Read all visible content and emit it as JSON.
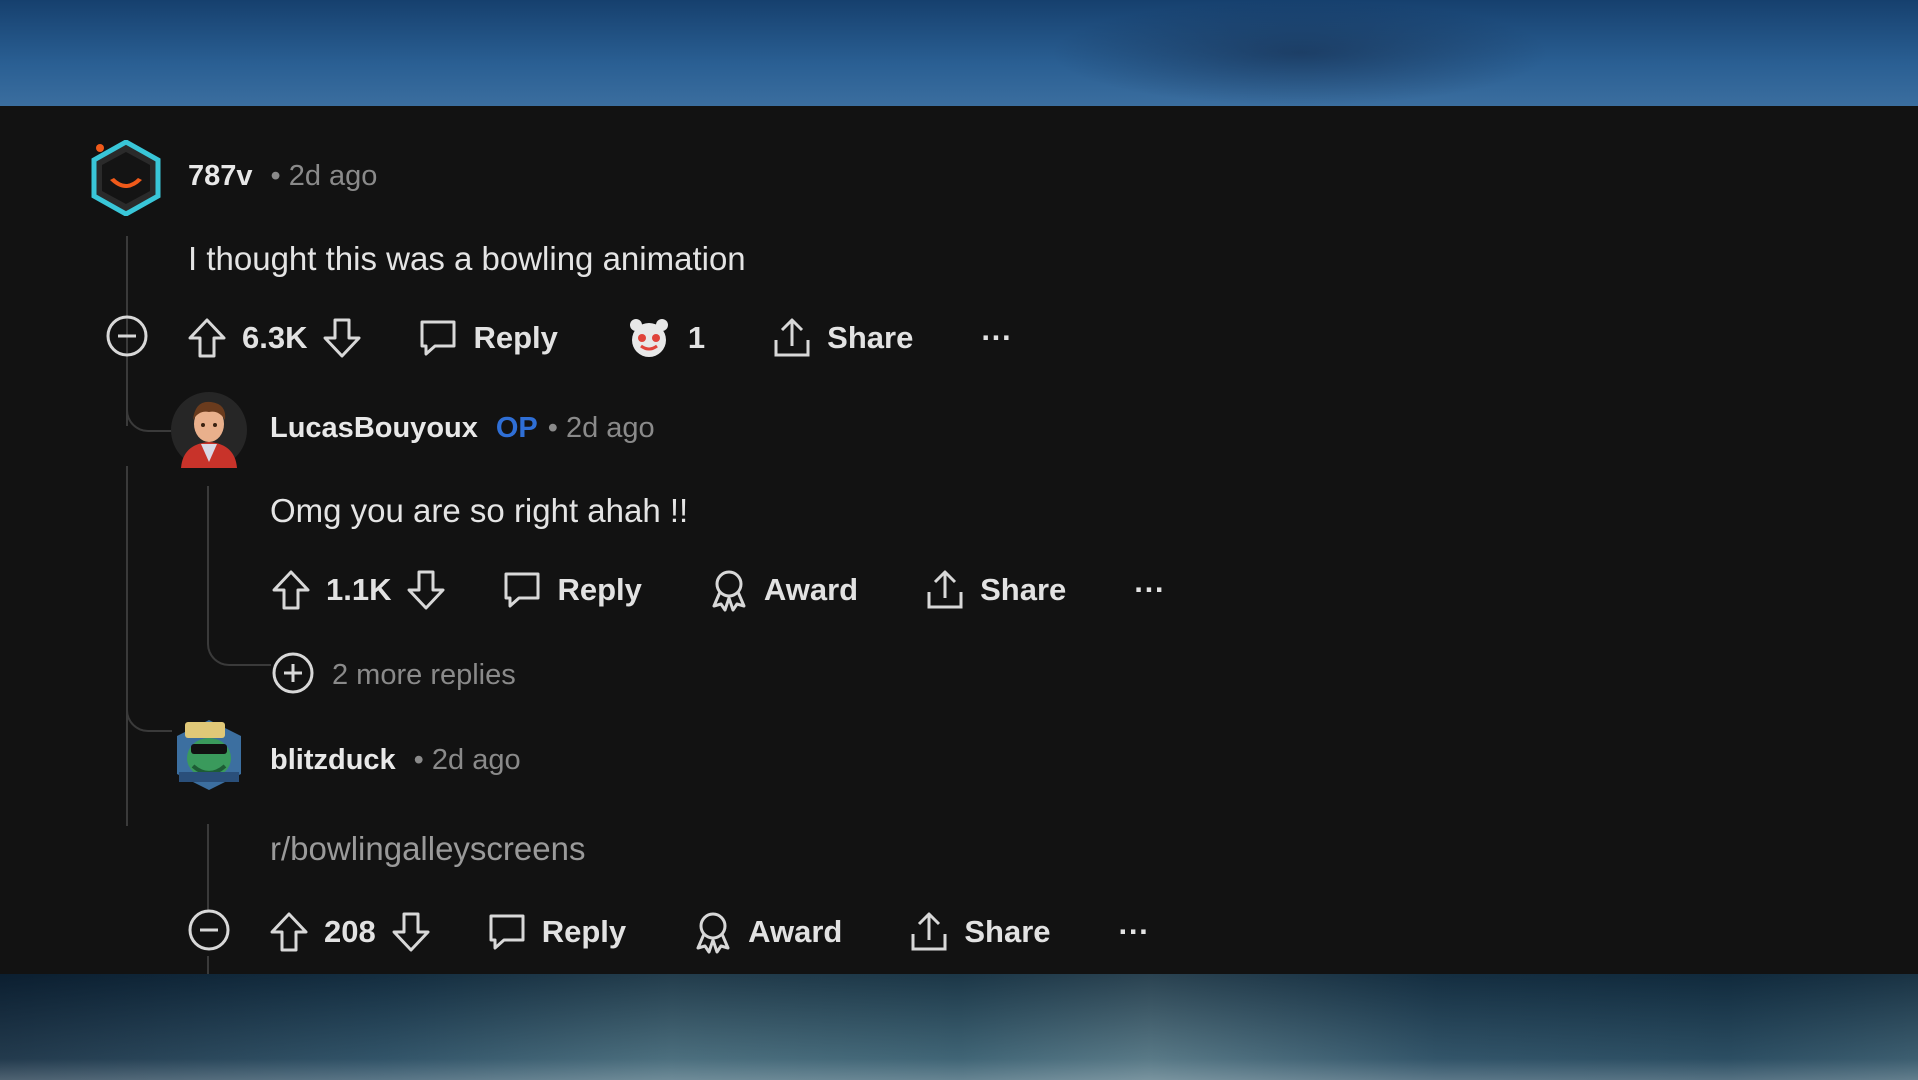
{
  "comments": [
    {
      "username": "787v",
      "time": "• 2d ago",
      "text": "I thought this was a bowling animation",
      "score": "6.3K",
      "reply_label": "Reply",
      "award_count": "1",
      "share_label": "Share",
      "more_label": "···"
    },
    {
      "username": "LucasBouyoux",
      "op_badge": "OP",
      "time": "• 2d ago",
      "text": "Omg you are so right ahah !!",
      "score": "1.1K",
      "reply_label": "Reply",
      "award_label": "Award",
      "share_label": "Share",
      "more_label": "···",
      "more_replies": "2 more replies"
    },
    {
      "username": "blitzduck",
      "time": "• 2d ago",
      "text": "r/bowlingalleyscreens",
      "score": "208",
      "reply_label": "Reply",
      "award_label": "Award",
      "share_label": "Share",
      "more_label": "···"
    }
  ],
  "colors": {
    "panel_bg": "#121212",
    "text_primary": "#e4e4e4",
    "text_meta": "#8a8a8a",
    "op_blue": "#2f6fd6",
    "thread_line": "#3a3a3a"
  },
  "icons": [
    "collapse-icon",
    "upvote-icon",
    "downvote-icon",
    "comment-icon",
    "award-icon",
    "share-icon",
    "expand-icon",
    "overflow-icon"
  ]
}
